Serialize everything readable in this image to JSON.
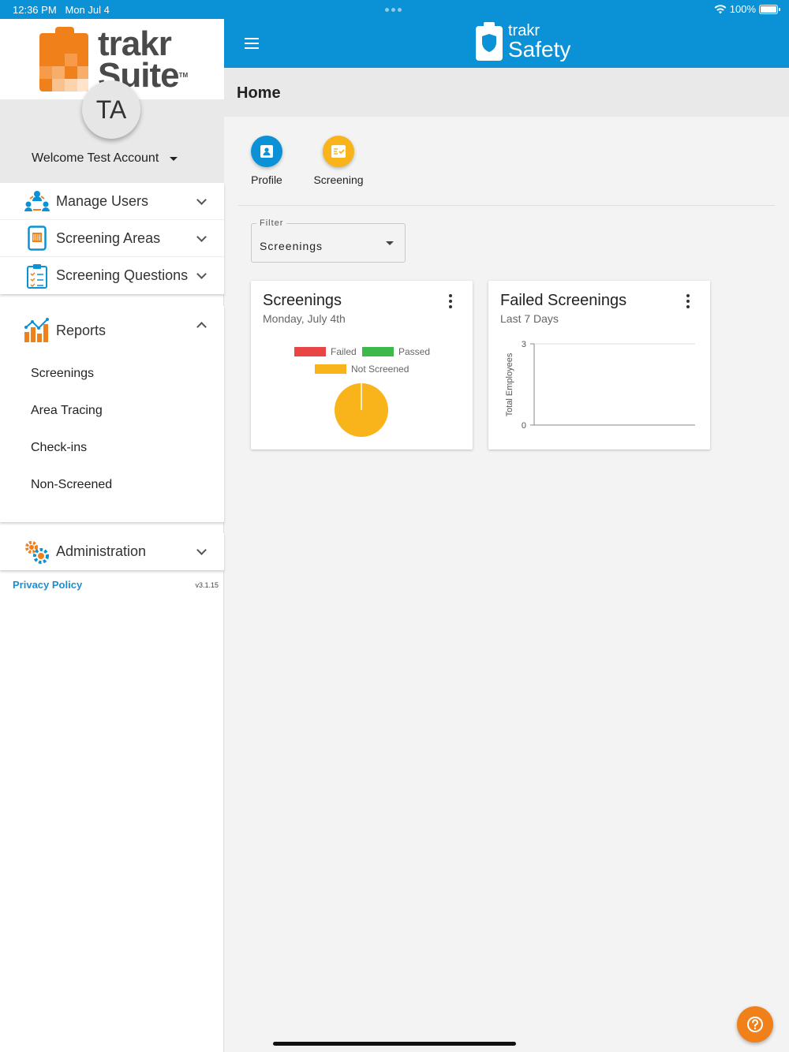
{
  "status": {
    "time": "12:36 PM",
    "date": "Mon Jul 4",
    "battery": "100%"
  },
  "brand": {
    "word1": "trakr",
    "word2": "Suite",
    "tm": "TM"
  },
  "user": {
    "initials": "TA",
    "welcome": "Welcome Test Account"
  },
  "sidebar": {
    "items": [
      {
        "label": "Manage Users"
      },
      {
        "label": "Screening Areas"
      },
      {
        "label": "Screening Questions"
      }
    ],
    "reports": {
      "label": "Reports",
      "subitems": [
        "Screenings",
        "Area Tracing",
        "Check-ins",
        "Non-Screened"
      ]
    },
    "administration": {
      "label": "Administration"
    },
    "privacy": "Privacy Policy",
    "version": "v3.1.15"
  },
  "appbar": {
    "logo_word1": "trakr",
    "logo_word2": "Safety"
  },
  "page": {
    "title": "Home"
  },
  "quick_actions": [
    {
      "label": "Profile",
      "color": "#0a91d6"
    },
    {
      "label": "Screening",
      "color": "#f8b41a"
    }
  ],
  "filter": {
    "label": "Filter",
    "value": "Screenings"
  },
  "cards": {
    "screenings": {
      "title": "Screenings",
      "subtitle": "Monday, July 4th"
    },
    "failed": {
      "title": "Failed Screenings",
      "subtitle": "Last 7 Days"
    }
  },
  "chart_data": [
    {
      "type": "pie",
      "categories": [
        "Failed",
        "Passed",
        "Not Screened"
      ],
      "values": [
        0,
        0,
        1
      ],
      "colors": [
        "#e94545",
        "#3cb94a",
        "#f8b41a"
      ],
      "legend": "top"
    },
    {
      "type": "line",
      "ylabel": "Total Employees",
      "yticks": [
        "3",
        "0"
      ],
      "ylim": [
        0,
        3
      ],
      "series": []
    }
  ]
}
